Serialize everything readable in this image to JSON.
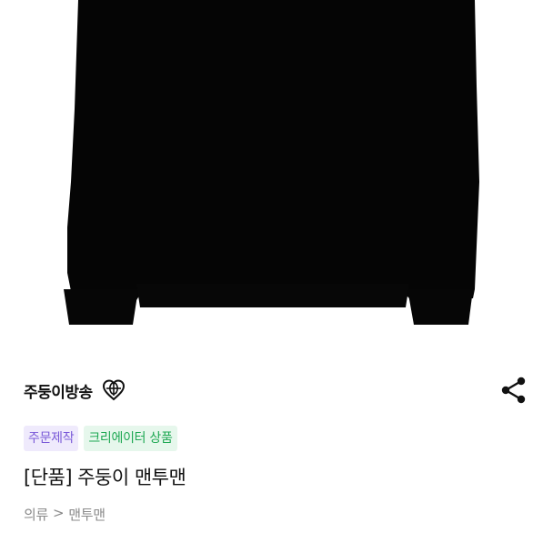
{
  "product_image": {
    "subject": "black sweatshirt",
    "color": "#050505"
  },
  "seller": {
    "name": "주둥이방송",
    "badge_icon": "heart-globe-icon"
  },
  "share_button": {
    "icon": "share-icon"
  },
  "tags": [
    {
      "label": "주문제작",
      "color": "#7a5ad8",
      "background": "#efeafc"
    },
    {
      "label": "크리에이터 상품",
      "color": "#1ea853",
      "background": "#e6f7ec"
    }
  ],
  "product": {
    "title": "[단품] 주둥이 맨투맨"
  },
  "breadcrumb": {
    "category": "의류",
    "separator": ">",
    "subcategory": "맨투맨"
  }
}
